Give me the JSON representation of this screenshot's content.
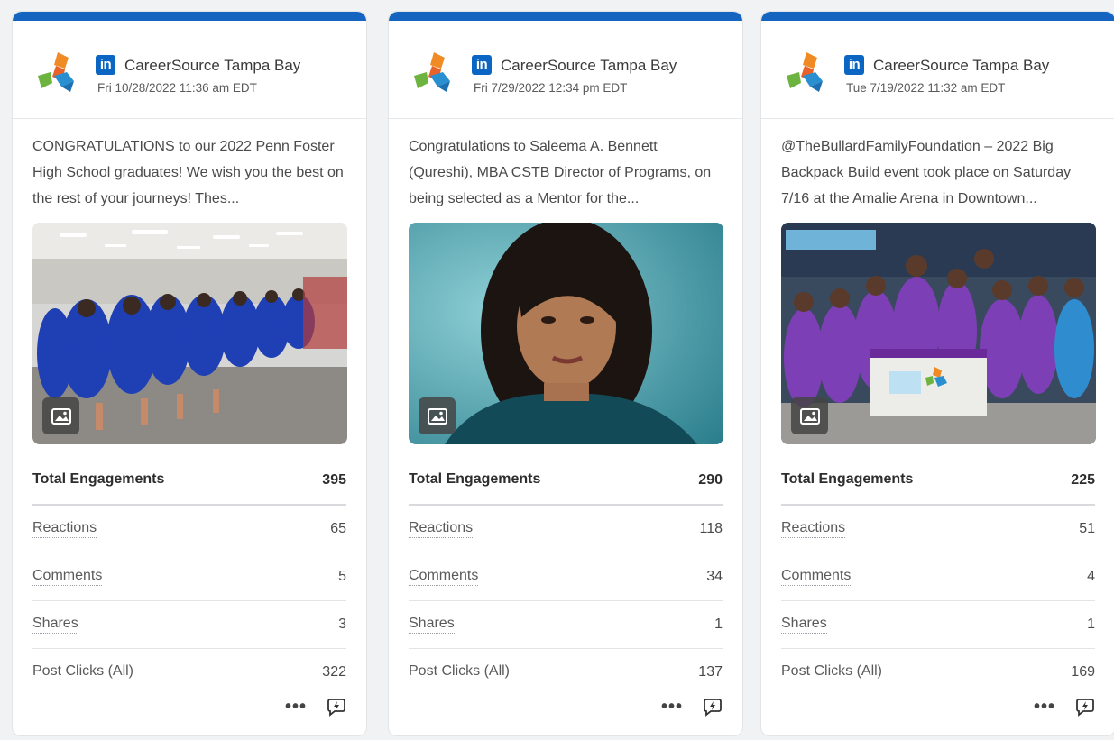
{
  "colors": {
    "accent_bar": "#1565c0",
    "linkedin_blue": "#0a66c2"
  },
  "cards": [
    {
      "network_icon": "linkedin-icon",
      "network_badge": "in",
      "account": "CareerSource Tampa Bay",
      "date": "Fri 10/28/2022 11:36 am EDT",
      "text": "CONGRATULATIONS to our 2022 Penn Foster High School graduates! We wish you the best on the rest of your journeys! Thes...",
      "image_type_icon": "image-icon",
      "metrics": {
        "total_label": "Total Engagements",
        "total": "395",
        "reactions_label": "Reactions",
        "reactions": "65",
        "comments_label": "Comments",
        "comments": "5",
        "shares_label": "Shares",
        "shares": "3",
        "clicks_label": "Post Clicks (All)",
        "clicks": "322"
      },
      "more_label": "•••"
    },
    {
      "network_icon": "linkedin-icon",
      "network_badge": "in",
      "account": "CareerSource Tampa Bay",
      "date": "Fri 7/29/2022 12:34 pm EDT",
      "text": "Congratulations to Saleema A. Bennett (Qureshi), MBA CSTB Director of Programs, on being selected as a Mentor for the...",
      "image_type_icon": "image-icon",
      "metrics": {
        "total_label": "Total Engagements",
        "total": "290",
        "reactions_label": "Reactions",
        "reactions": "118",
        "comments_label": "Comments",
        "comments": "34",
        "shares_label": "Shares",
        "shares": "1",
        "clicks_label": "Post Clicks (All)",
        "clicks": "137"
      },
      "more_label": "•••"
    },
    {
      "network_icon": "linkedin-icon",
      "network_badge": "in",
      "account": "CareerSource Tampa Bay",
      "date": "Tue 7/19/2022 11:32 am EDT",
      "text": "@TheBullardFamilyFoundation – 2022 Big Backpack Build event took place on Saturday 7/16 at the Amalie Arena in Downtown...",
      "image_type_icon": "image-icon",
      "metrics": {
        "total_label": "Total Engagements",
        "total": "225",
        "reactions_label": "Reactions",
        "reactions": "51",
        "comments_label": "Comments",
        "comments": "4",
        "shares_label": "Shares",
        "shares": "1",
        "clicks_label": "Post Clicks (All)",
        "clicks": "169"
      },
      "more_label": "•••"
    }
  ]
}
